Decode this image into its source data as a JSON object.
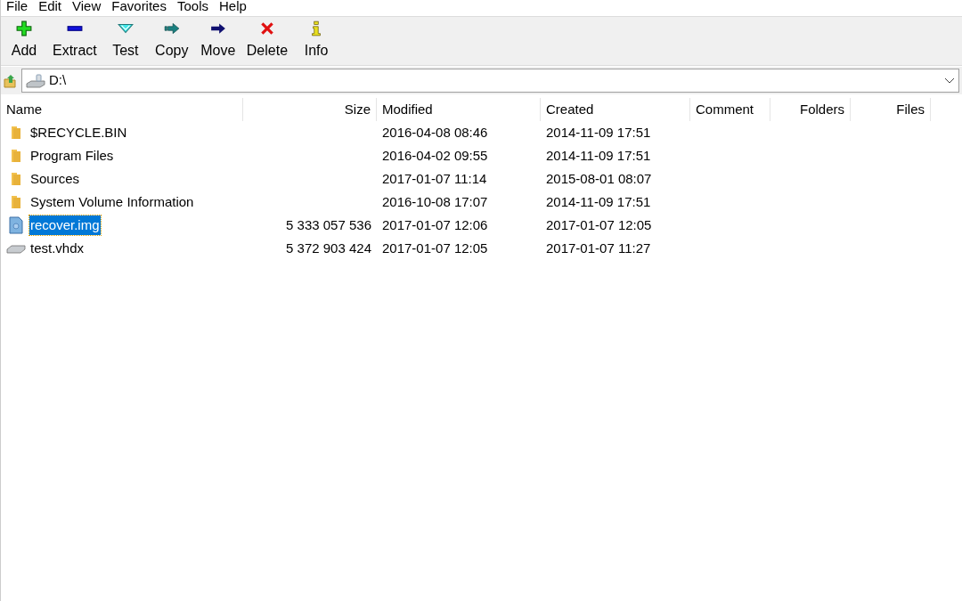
{
  "menu": [
    "File",
    "Edit",
    "View",
    "Favorites",
    "Tools",
    "Help"
  ],
  "toolbar": [
    {
      "kind": "add",
      "label": "Add"
    },
    {
      "kind": "extract",
      "label": "Extract"
    },
    {
      "kind": "test",
      "label": "Test"
    },
    {
      "kind": "copy",
      "label": "Copy"
    },
    {
      "kind": "move",
      "label": "Move"
    },
    {
      "kind": "delete",
      "label": "Delete"
    },
    {
      "kind": "info",
      "label": "Info"
    }
  ],
  "address": {
    "value": "D:\\"
  },
  "table": {
    "columns": [
      "Name",
      "Size",
      "Modified",
      "Created",
      "Comment",
      "Folders",
      "Files"
    ],
    "rows": [
      {
        "kind": "folder",
        "name": "$RECYCLE.BIN",
        "size": "",
        "modified": "2016-04-08 08:46",
        "created": "2014-11-09 17:51",
        "selected": false
      },
      {
        "kind": "folder",
        "name": "Program Files",
        "size": "",
        "modified": "2016-04-02 09:55",
        "created": "2014-11-09 17:51",
        "selected": false
      },
      {
        "kind": "folder",
        "name": "Sources",
        "size": "",
        "modified": "2017-01-07 11:14",
        "created": "2015-08-01 08:07",
        "selected": false
      },
      {
        "kind": "folder",
        "name": "System Volume Information",
        "size": "",
        "modified": "2016-10-08 17:07",
        "created": "2014-11-09 17:51",
        "selected": false
      },
      {
        "kind": "image",
        "name": "recover.img",
        "size": "5 333 057 536",
        "modified": "2017-01-07 12:06",
        "created": "2017-01-07 12:05",
        "selected": true
      },
      {
        "kind": "disk",
        "name": "test.vhdx",
        "size": "5 372 903 424",
        "modified": "2017-01-07 12:05",
        "created": "2017-01-07 11:27",
        "selected": false
      }
    ]
  }
}
